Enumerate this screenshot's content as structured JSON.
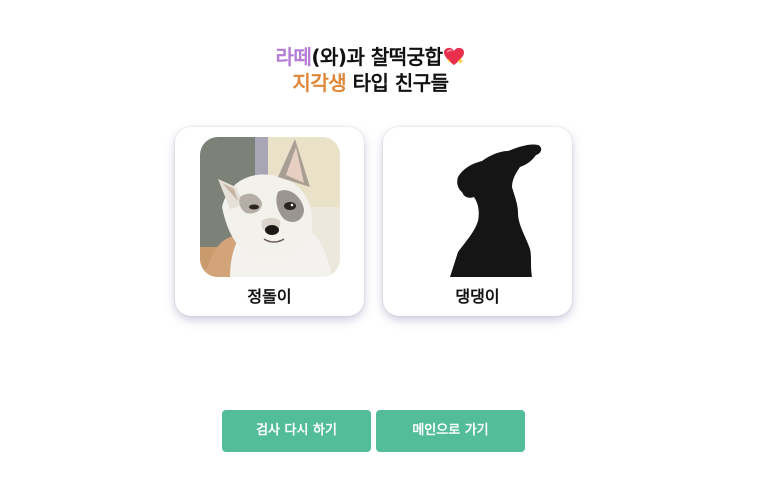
{
  "heading": {
    "line1_highlight": "라떼",
    "line1_rest": "(와)과 찰떡궁합",
    "line2_highlight": "지각생",
    "line2_rest": " 타입 친구들",
    "heart_icon": "sparkling-heart-icon"
  },
  "colors": {
    "highlight_purple": "#b57cd6",
    "highlight_orange": "#e0883a",
    "button_green": "#52bd98"
  },
  "friends": [
    {
      "name": "정돌이",
      "image": "dog-photo"
    },
    {
      "name": "댕댕이",
      "image": "dog-silhouette"
    }
  ],
  "buttons": {
    "retry_label": "검사 다시 하기",
    "main_label": "메인으로 가기"
  }
}
